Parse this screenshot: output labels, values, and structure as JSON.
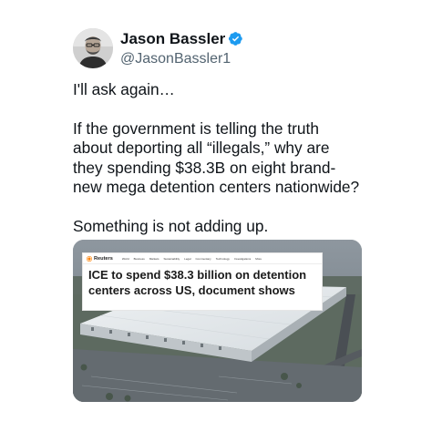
{
  "author": {
    "display_name": "Jason Bassler",
    "handle": "@JasonBassler1",
    "verified": true,
    "verified_color": "#1d9bf0"
  },
  "tweet": {
    "paragraphs": [
      [
        "I'll ask again…"
      ],
      [
        "If the government is telling the truth",
        "about deporting all “illegals,” why are",
        "they spending $38.3B on eight brand-",
        "new mega detention centers nationwide?"
      ],
      [
        "Something is not adding up."
      ]
    ]
  },
  "media": {
    "publication": "Reuters",
    "brand_color": "#ff8000",
    "nav_items": [
      "World",
      "Business",
      "Markets",
      "Sustainability",
      "Legal",
      "Commentary",
      "Technology",
      "Investigations",
      "More"
    ],
    "headline_lines": [
      "ICE to spend $38.3 billion on detention",
      "centers across US, document shows"
    ]
  },
  "icons": {
    "verified": "verified-badge-icon",
    "logo": "reuters-logo-icon"
  }
}
